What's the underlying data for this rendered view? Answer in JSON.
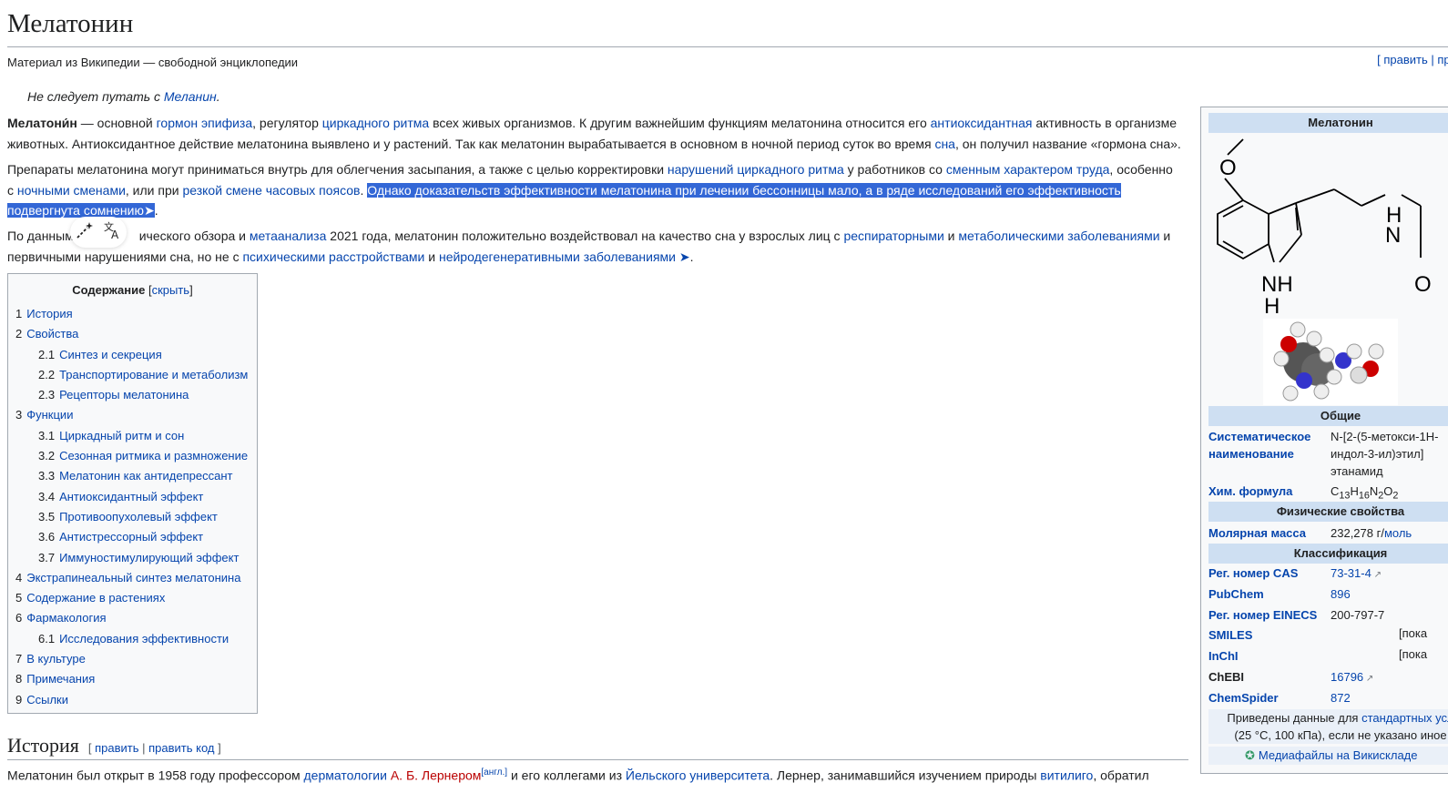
{
  "page": {
    "title": "Мелатонин",
    "sitesub": "Материал из Википедии — свободной энциклопедии",
    "edit_top": "[ править | правит"
  },
  "hatnote": {
    "prefix": "Не следует путать с ",
    "link": "Меланин",
    "suffix": "."
  },
  "p1": {
    "bold": "Мелатони́н",
    "t1": " — основной ",
    "l1": "гормон эпифиза",
    "t2": ", регулятор ",
    "l2": "циркадного ритма",
    "t3": " всех живых организмов. К другим важнейшим функциям мелатонина относится его ",
    "l3": "антиоксидантная",
    "t4": " активность в организме животных. Антиоксидантное действие мелатонина выявлено и у растений. Так как мелатонин вырабатывается в основном в ночной период суток во время ",
    "l4": "сна",
    "t5": ", он получил название «гормона сна»."
  },
  "p2": {
    "t1": "Препараты мелатонина могут приниматься внутрь для облегчения засыпания, а также с целью корректировки ",
    "l1": "нарушений циркадного ритма",
    "t2": " у работников со ",
    "l2": "сменным характером труда",
    "t3": ", особенно с ",
    "l3": "ночными сменами",
    "t4": ", или при ",
    "l4": "резкой смене часовых поясов",
    "t5": ". ",
    "selected": "Однако доказательств эффективности мелатонина при лечении бессонницы мало, а в ряде исследований его эффективность подвергнута сомнению",
    "arrow": "➤",
    "end": "."
  },
  "p3": {
    "t1": "По данным ",
    "t1b": "ического обзора и ",
    "l1": "метаанализа",
    "t2": " 2021 года, мелатонин положительно воздействовал на качество сна у взрослых лиц с ",
    "l2": "респираторными",
    "t3": " и ",
    "l3": "метаболическими заболеваниями",
    "t4": " и первичными нарушениями сна, но не с ",
    "l4": "психическими расстройствами",
    "t5": " и ",
    "l5": "нейродегенеративными заболеваниями",
    "arrow": " ➤",
    "end": "."
  },
  "popup": {
    "magic_icon": "magic-wand-icon",
    "translate_icon": "translate-icon"
  },
  "toc": {
    "title": "Содержание",
    "hide_open": " [",
    "hide": "скрыть",
    "hide_close": "]",
    "items": [
      {
        "num": "1",
        "label": "История",
        "level": 1
      },
      {
        "num": "2",
        "label": "Свойства",
        "level": 1
      },
      {
        "num": "2.1",
        "label": "Синтез и секреция",
        "level": 2
      },
      {
        "num": "2.2",
        "label": "Транспортирование и метаболизм",
        "level": 2
      },
      {
        "num": "2.3",
        "label": "Рецепторы мелатонина",
        "level": 2
      },
      {
        "num": "3",
        "label": "Функции",
        "level": 1
      },
      {
        "num": "3.1",
        "label": "Циркадный ритм и сон",
        "level": 2
      },
      {
        "num": "3.2",
        "label": "Сезонная ритмика и размножение",
        "level": 2
      },
      {
        "num": "3.3",
        "label": "Мелатонин как антидепрессант",
        "level": 2
      },
      {
        "num": "3.4",
        "label": "Антиоксидантный эффект",
        "level": 2
      },
      {
        "num": "3.5",
        "label": "Противоопухолевый эффект",
        "level": 2
      },
      {
        "num": "3.6",
        "label": "Антистрессорный эффект",
        "level": 2
      },
      {
        "num": "3.7",
        "label": "Иммуностимулирующий эффект",
        "level": 2
      },
      {
        "num": "4",
        "label": "Экстрапинеальный синтез мелатонина",
        "level": 1
      },
      {
        "num": "5",
        "label": "Содержание в растениях",
        "level": 1
      },
      {
        "num": "6",
        "label": "Фармакология",
        "level": 1
      },
      {
        "num": "6.1",
        "label": "Исследования эффективности",
        "level": 2
      },
      {
        "num": "7",
        "label": "В культуре",
        "level": 1
      },
      {
        "num": "8",
        "label": "Примечания",
        "level": 1
      },
      {
        "num": "9",
        "label": "Ссылки",
        "level": 1
      }
    ]
  },
  "history": {
    "title": "История",
    "edit_open": "[ ",
    "edit": "править",
    "sep": " | ",
    "edit_code": "править код",
    "edit_close": " ]",
    "t1": "Мелатонин был открыт в 1958 году профессором ",
    "l1": "дерматологии",
    "t2": " ",
    "l2": "А. Б. Лернером",
    "sup": "[англ.]",
    "t3": " и его коллегами из ",
    "l3": "Йельского университета",
    "t4": ". Лернер, занимавшийся изучением природы ",
    "l4": "витилиго",
    "t5": ", обратил"
  },
  "infobox": {
    "title": "Мелатонин",
    "struct": {
      "o_top": "O",
      "h": "H",
      "n": "N",
      "nh": "NH",
      "n_bottom": "H",
      "o_right": "O"
    },
    "general": "Общие",
    "sys_label": "Систематическое наименование",
    "sys_l1": "N-[2-(5-метокси-1H-",
    "sys_l2": "индол-3-ил)этил]",
    "sys_l3": "этанамид",
    "formula_label": "Хим. формула",
    "formula": {
      "c": "C",
      "c_n": "13",
      "h": "H",
      "h_n": "16",
      "n": "N",
      "n_n": "2",
      "o": "O",
      "o_n": "2"
    },
    "phys": "Физические свойства",
    "molar_label": "Молярная масса",
    "molar_value": "232,278 г/",
    "molar_unit": "моль",
    "class": "Классификация",
    "cas_label": "Рег. номер CAS",
    "cas_value": "73-31-4",
    "pubchem_label": "PubChem",
    "pubchem_value": "896",
    "einecs_label": "Рег. номер EINECS",
    "einecs_value": "200-797-7",
    "smiles_label": "SMILES",
    "smiles_value": "[пока",
    "inchi_label": "InChI",
    "inchi_value": "[пока",
    "chebi_label": "ChEBI",
    "chebi_value": "16796",
    "chemspider_label": "ChemSpider",
    "chemspider_value": "872",
    "note_l1_a": "Приведены данные для ",
    "note_l1_link": "стандартных усл",
    "note_l2": "(25 °C, 100 кПа), если не указано иное",
    "commons": "Медиафайлы на Викискладе"
  }
}
